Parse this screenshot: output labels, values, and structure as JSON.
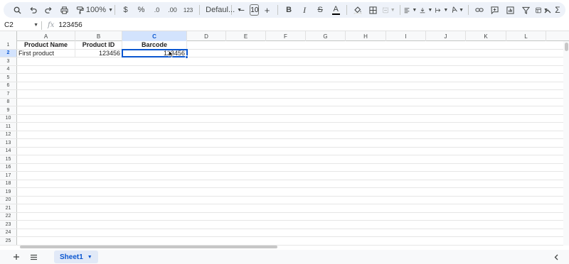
{
  "toolbar": {
    "zoom": "100%",
    "currency": "$",
    "percent": "%",
    "decrease_decimal": ".0",
    "increase_decimal": ".00",
    "number_format": "123",
    "font": "Defaul...",
    "font_size": "10",
    "minus": "−",
    "plus": "+",
    "bold": "B",
    "italic": "I",
    "strike": "S",
    "text_color": "A",
    "text_color_bar": "#000000",
    "fill_color_bar": "#ffffff"
  },
  "formula_bar": {
    "cell_ref": "C2",
    "fx": "fx",
    "value": "123456"
  },
  "columns": [
    "A",
    "B",
    "C",
    "D",
    "E",
    "F",
    "G",
    "H",
    "I",
    "J",
    "K",
    "L"
  ],
  "selected_column": "C",
  "row_numbers": [
    "1",
    "2",
    "3",
    "4",
    "5",
    "6",
    "7",
    "8",
    "9",
    "10",
    "11",
    "12",
    "13",
    "14",
    "15",
    "16",
    "17",
    "18",
    "19",
    "20",
    "21",
    "22",
    "23",
    "24",
    "25"
  ],
  "selected_row": "2",
  "cells": {
    "A1": "Product Name",
    "B1": "Product ID",
    "C1": "Barcode",
    "A2": "First product",
    "B2": "123456",
    "C2": "123456"
  },
  "sheets": {
    "active_tab": "Sheet1"
  },
  "colors": {
    "accent": "#0b57d0",
    "selection_bg": "#d3e3fd",
    "toolbar_bg": "#eef2f9"
  },
  "icons": [
    "search-icon",
    "undo-icon",
    "redo-icon",
    "print-icon",
    "paint-format-icon",
    "fill-color-icon",
    "borders-icon",
    "merge-cells-icon",
    "align-icon",
    "valign-icon",
    "text-rotation-icon",
    "link-icon",
    "comment-icon",
    "chart-icon",
    "filter-icon",
    "filter-views-icon",
    "functions-icon",
    "collapse-icon",
    "add-sheet-icon",
    "all-sheets-icon"
  ]
}
